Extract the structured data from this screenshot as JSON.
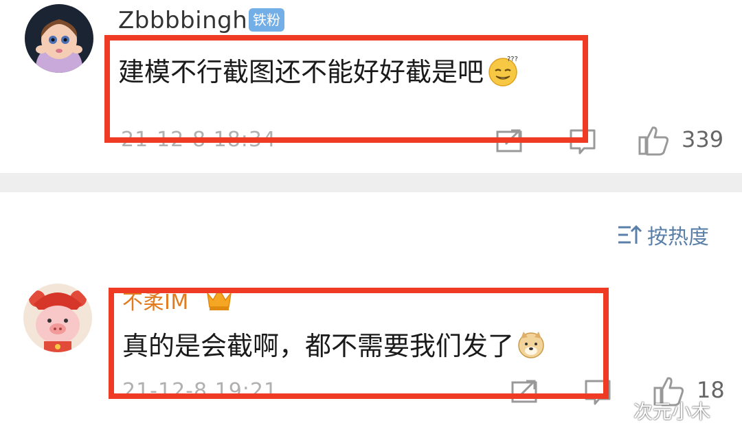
{
  "comments": [
    {
      "username": "Zbbbbingh",
      "badge": "铁粉",
      "text": "建模不行截图还不能好好截是吧",
      "emoji": "dizzy-smile-emoji",
      "timestamp": "21-12-8 18:34",
      "likes": "339"
    },
    {
      "username": "不柔IM",
      "text": "真的是会截啊，都不需要我们发了",
      "emoji": "doge-emoji",
      "timestamp": "21-12-8 19:21",
      "likes": "18"
    }
  ],
  "sort": {
    "label": "按热度"
  },
  "watermark": "次元小木",
  "colors": {
    "highlight": "#ef3a24",
    "badge": "#74aee6",
    "sort": "#5a7fa8",
    "username2": "#e07b1e"
  }
}
